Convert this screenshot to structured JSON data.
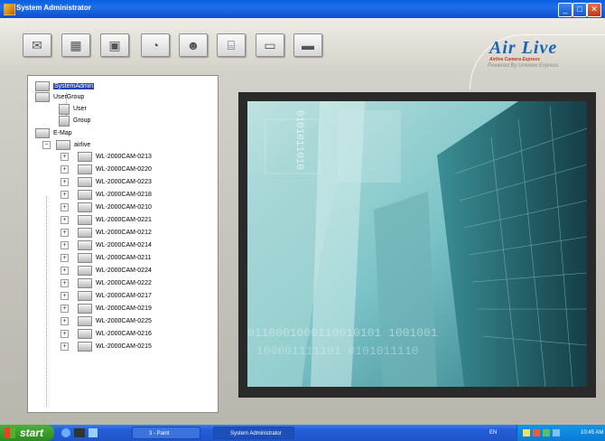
{
  "window": {
    "title": "System Administrator"
  },
  "toolbar": {
    "buttons": [
      {
        "icon": "envelope-icon",
        "glyph": "✉"
      },
      {
        "icon": "grid-icon",
        "glyph": "▦"
      },
      {
        "icon": "chip-icon",
        "glyph": "▣"
      },
      {
        "icon": "chart-icon",
        "glyph": "◔"
      },
      {
        "icon": "user-group-icon",
        "glyph": "☻"
      },
      {
        "icon": "network-icon",
        "glyph": "⌸"
      },
      {
        "icon": "monitor-icon",
        "glyph": "▭"
      },
      {
        "icon": "device-icon",
        "glyph": "▬"
      }
    ]
  },
  "logo": {
    "brand": "Air Live",
    "tagline": "Airlive Camera Express",
    "powered": "Powered By Uniview Express"
  },
  "tree": {
    "system": "SystemAdmin",
    "usergroup": "UserGroup",
    "user": "User",
    "group": "Group",
    "emap": "E-Map",
    "airlive": "airlive",
    "cameras": [
      "WL-2000CAM-0213",
      "WL-2000CAM-0220",
      "WL-2000CAM-0223",
      "WL-2000CAM-0218",
      "WL-2000CAM-0210",
      "WL-2000CAM-0221",
      "WL-2000CAM-0212",
      "WL-2000CAM-0214",
      "WL-2000CAM-0211",
      "WL-2000CAM-0224",
      "WL-2000CAM-0222",
      "WL-2000CAM-0217",
      "WL-2000CAM-0219",
      "WL-2000CAM-0225",
      "WL-2000CAM-0216",
      "WL-2000CAM-0215"
    ]
  },
  "image": {
    "binary1": "0101011010",
    "binary2": "0110001000110010101 1001001",
    "binary3": "100001111101 0101011110"
  },
  "taskbar": {
    "start": "start",
    "task1": "3 - Paint",
    "task2": "System Administrator",
    "lang": "EN",
    "clock": "10:45 AM"
  },
  "colors": {
    "titlebar": "#0b5fe0",
    "accent": "#1c64b8",
    "image_teal": "#5fb8c0"
  }
}
